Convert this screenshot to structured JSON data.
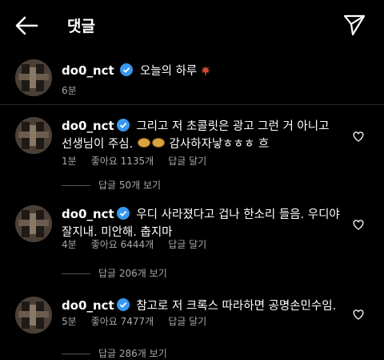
{
  "header": {
    "title": "댓글"
  },
  "caption": {
    "username": "do0_nct",
    "text": "오늘의 하루",
    "emoji": "maple-leaf-icon",
    "time": "6분"
  },
  "comments": [
    {
      "username": "do0_nct",
      "text_a": "그리고 저 초콜릿은 광고 그런 거 아니고 선생님이 주심.",
      "text_b": "감사하자낳ㅎㅎㅎ 흐",
      "time": "1분",
      "likes": "좋아요 1135개",
      "reply": "답글 달기",
      "replies": "답글 50개 보기"
    },
    {
      "username": "do0_nct",
      "text": "우디 사라졌다고 겁나 한소리 들음. 우디야 잘지내. 미안해. 춥지마",
      "time": "4분",
      "likes": "좋아요 6444개",
      "reply": "답글 달기",
      "replies": "답글 206개 보기"
    },
    {
      "username": "do0_nct",
      "text": "참고로 저 크록스 따라하면 공명손민수임.",
      "time": "5분",
      "likes": "좋아요 7477개",
      "reply": "답글 달기",
      "replies": "답글 286개 보기"
    }
  ],
  "colors": {
    "background": "#000000",
    "meta": "#a8a8a8",
    "verified": "#3897f0",
    "divider": "#262626"
  }
}
